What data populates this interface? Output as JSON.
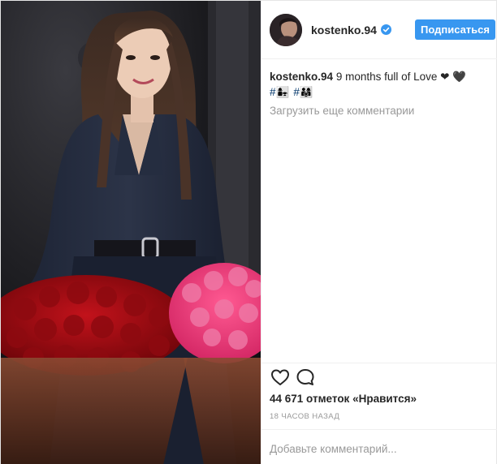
{
  "post": {
    "username": "kostenko.94",
    "verified": true,
    "follow_label": "Подписаться",
    "caption": {
      "username": "kostenko.94",
      "text": "9 months full of Love ❤ 🖤",
      "hashtags": [
        "#👩‍👧",
        "#👨‍👩‍👧"
      ]
    },
    "load_more_label": "Загрузить еще комментарии",
    "likes_text": "44 671 отметок «Нравится»",
    "time_text": "18 ЧАСОВ НАЗАД",
    "comment_placeholder": "Добавьте комментарий...",
    "icons": {
      "like": "heart-icon",
      "comment": "comment-bubble-icon",
      "verified": "verified-badge-icon"
    },
    "colors": {
      "follow_button": "#3897f0",
      "verified_badge": "#3897f0",
      "secondary_text": "#999999",
      "hashtag": "#003569"
    }
  }
}
